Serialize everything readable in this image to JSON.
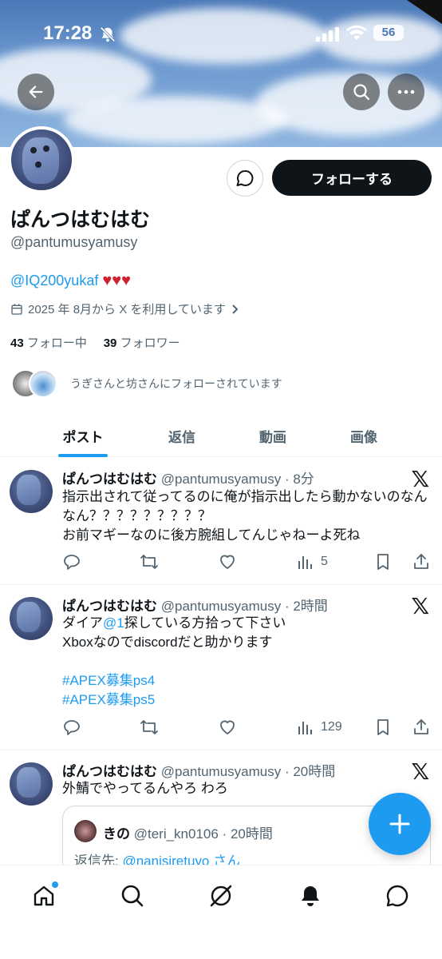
{
  "status_bar": {
    "time": "17:28",
    "battery": "56"
  },
  "profile": {
    "name": "ぱんつはむはむ",
    "handle": "@pantumusyamusy",
    "bio_link": "@IQ200yukaf",
    "bio_hearts": "♥♥♥",
    "joined": "2025 年 8月から X を利用しています",
    "following_count": "43",
    "following_label": "フォロー中",
    "followers_count": "39",
    "followers_label": "フォロワー",
    "followed_by": "うぎさんと坊さんにフォローされています",
    "follow_button": "フォローする"
  },
  "tabs": [
    {
      "label": "ポスト"
    },
    {
      "label": "返信"
    },
    {
      "label": "動画"
    },
    {
      "label": "画像"
    }
  ],
  "posts": [
    {
      "name": "ぱんつはむはむ",
      "handle_time": "@pantumusyamusy · 8分",
      "text": "指示出されて従ってるのに俺が指示出したら動かないのなんなん？？？？？？？？？\nお前マギーなのに後方腕組してんじゃねーよ死ね",
      "views": "5"
    },
    {
      "name": "ぱんつはむはむ",
      "handle_time": "@pantumusyamusy · 2時間",
      "text_a": "ダイア",
      "text_link": "@1",
      "text_b": "探している方拾って下さい",
      "text_line2": "Xboxなのでdiscordだと助かります",
      "hashtag1": "#APEX募集ps4",
      "hashtag2": "#APEX募集ps5",
      "views": "129"
    },
    {
      "name": "ぱんつはむはむ",
      "handle_time": "@pantumusyamusy · 20時間",
      "text": "外鯖でやってるんやろ わろ",
      "quote": {
        "name": "きの",
        "handle_time": "@teri_kn0106 · 20時間",
        "reply_prefix": "返信先: ",
        "reply_to": "@nanisiretuyo",
        "reply_suffix": " さん"
      }
    }
  ],
  "colors": {
    "accent": "#1d9bf0",
    "text": "#0f1419",
    "muted": "#536471",
    "heart": "#d0212f"
  }
}
